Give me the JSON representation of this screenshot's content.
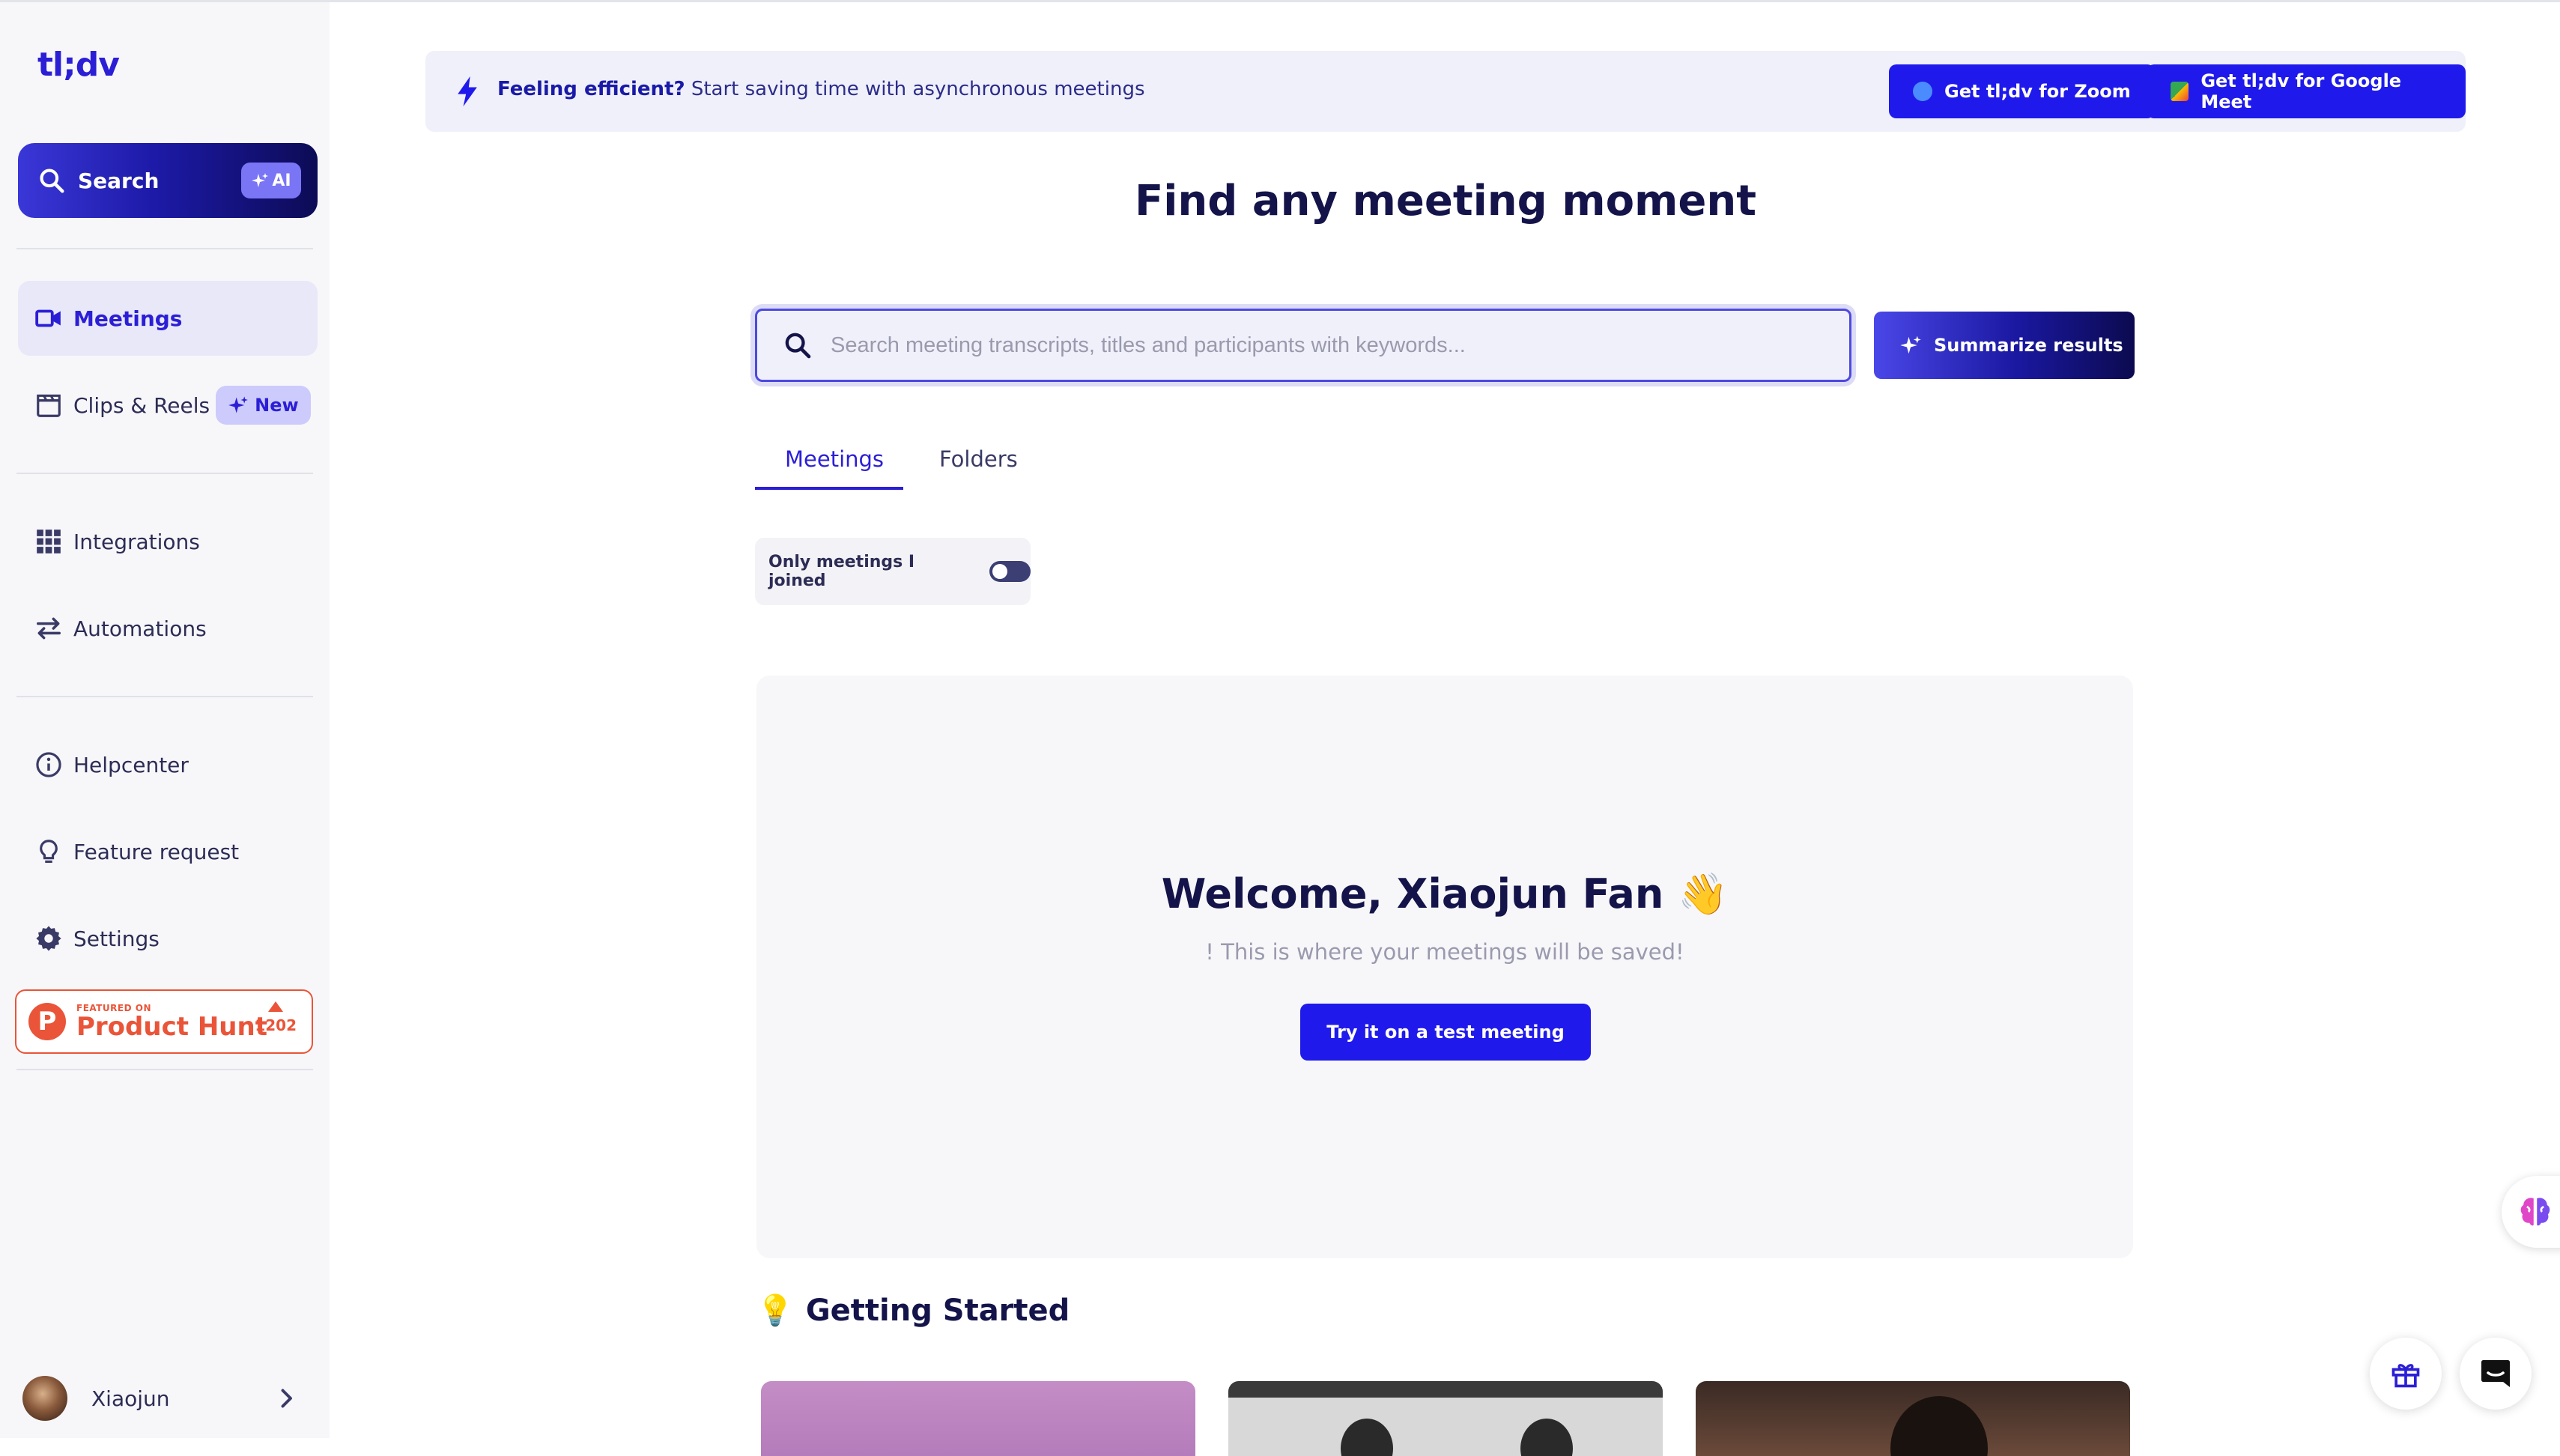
{
  "app": {
    "logo": "tl;dv"
  },
  "sidebar": {
    "search_label": "Search",
    "ai_label": "AI",
    "items": [
      {
        "label": "Meetings",
        "icon": "video-camera-icon",
        "active": true
      },
      {
        "label": "Clips & Reels",
        "icon": "clapperboard-icon",
        "badge": "New"
      },
      {
        "label": "Integrations",
        "icon": "grid-icon"
      },
      {
        "label": "Automations",
        "icon": "arrows-exchange-icon"
      },
      {
        "label": "Helpcenter",
        "icon": "info-icon"
      },
      {
        "label": "Feature request",
        "icon": "lightbulb-icon"
      },
      {
        "label": "Settings",
        "icon": "gear-icon"
      }
    ],
    "product_hunt": {
      "featured": "FEATURED ON",
      "name": "Product Hunt",
      "votes": "1202"
    },
    "user": {
      "name": "Xiaojun"
    }
  },
  "banner": {
    "bold": "Feeling efficient?",
    "text": "Start saving time with asynchronous meetings",
    "zoom_button": "Get tl;dv for Zoom",
    "meet_button": "Get tl;dv for Google Meet"
  },
  "main": {
    "title": "Find any meeting moment",
    "search_placeholder": "Search meeting transcripts, titles and participants with keywords...",
    "summarize_button": "Summarize results",
    "tabs": [
      {
        "label": "Meetings",
        "active": true
      },
      {
        "label": "Folders",
        "active": false
      }
    ],
    "toggle_label": "Only meetings I joined",
    "toggle_on": false,
    "welcome_title": "Welcome, Xiaojun Fan 👋",
    "welcome_sub": "! This is where your meetings will be saved!",
    "try_button": "Try it on a test meeting",
    "getting_started": "Getting Started",
    "getting_started_icon": "💡"
  },
  "colors": {
    "accent": "#2b1fd6",
    "button_blue": "#1f1aeb",
    "product_hunt": "#ea5438"
  }
}
